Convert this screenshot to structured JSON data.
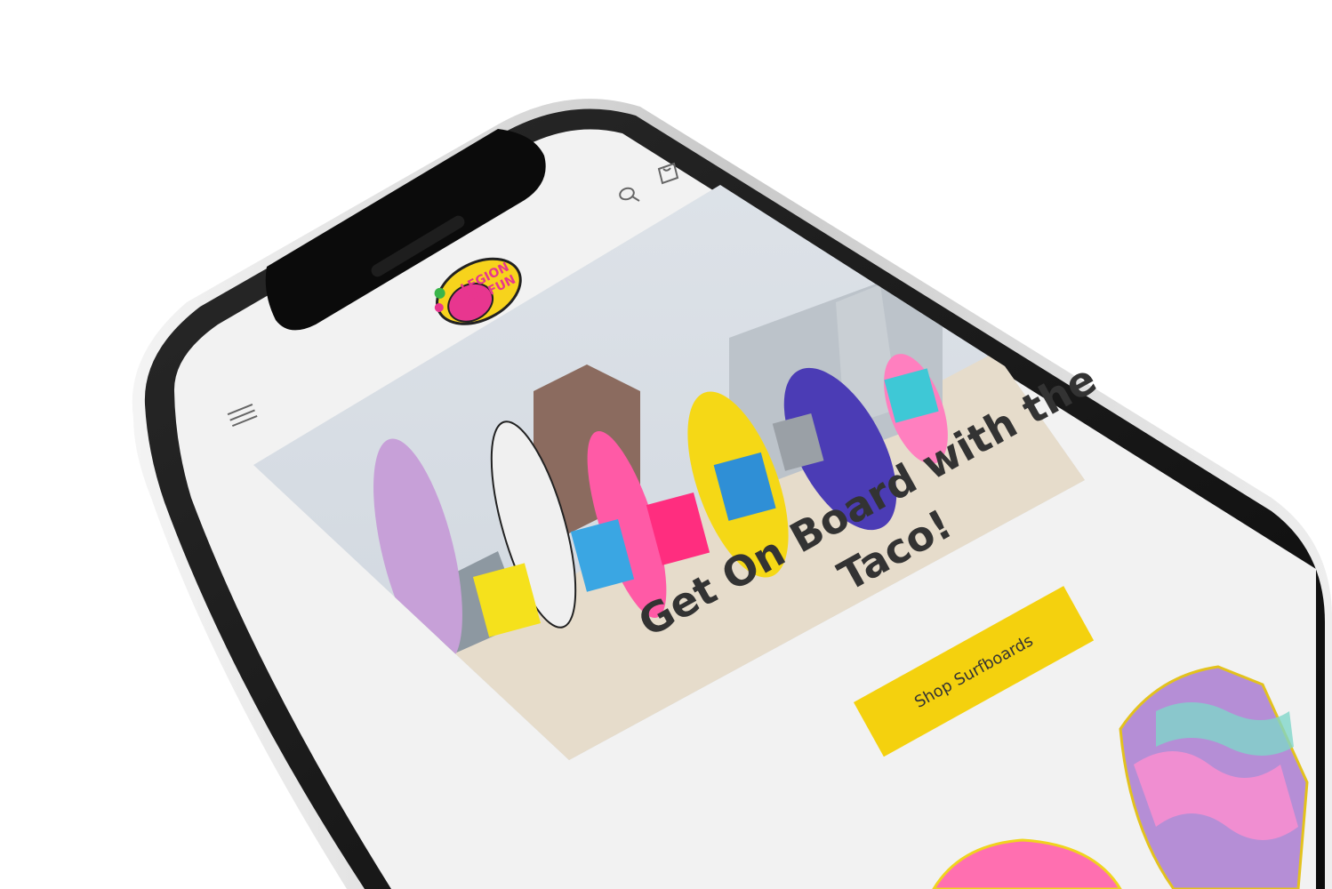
{
  "brand": {
    "logo_line1": "LEGION",
    "logo_line2": "OF FUN",
    "logo_icon": "taco-logo"
  },
  "header": {
    "menu_icon": "hamburger-menu-icon",
    "search_icon": "search-icon",
    "cart_icon": "cart-icon"
  },
  "hero": {
    "image": "kids-with-surfboards-on-beach"
  },
  "promo": {
    "headline": "Get On Board with the Taco!",
    "cta_label": "Shop Surfboards"
  },
  "colors": {
    "accent": "#f4d10e",
    "text": "#333333",
    "background": "#f2f2f2",
    "logo_yellow": "#f7d31c",
    "logo_pink": "#e8368f"
  }
}
